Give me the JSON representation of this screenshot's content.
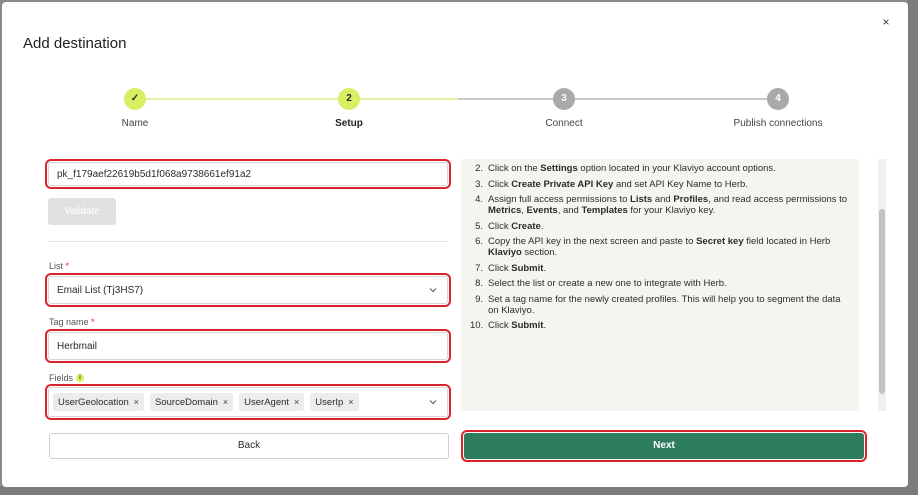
{
  "modal": {
    "title": "Add destination",
    "close_glyph": "×"
  },
  "stepper": {
    "steps": [
      {
        "label": "Name",
        "marker": "✓",
        "state": "done"
      },
      {
        "label": "Setup",
        "marker": "2",
        "state": "active"
      },
      {
        "label": "Connect",
        "marker": "3",
        "state": "pending"
      },
      {
        "label": "Publish connections",
        "marker": "4",
        "state": "pending"
      }
    ]
  },
  "form": {
    "api_key_value": "pk_f179aef22619b5d1f068a9738661ef91a2",
    "validate_label": "Validate",
    "list_label": "List",
    "list_value": "Email List (Tj3HS7)",
    "tag_label": "Tag name",
    "tag_value": "Herbmail",
    "fields_label": "Fields",
    "fields_info": "i",
    "required_mark": "*",
    "chip_remove": "×",
    "chips": [
      "UserGeolocation",
      "SourceDomain",
      "UserAgent",
      "UserIp"
    ]
  },
  "instructions": {
    "items": [
      {
        "num": "2.",
        "parts": [
          "Click on the ",
          "Settings",
          " option located in your Klaviyo account options."
        ]
      },
      {
        "num": "3.",
        "parts": [
          "Click ",
          "Create Private API Key",
          " and set API Key Name to Herb."
        ]
      },
      {
        "num": "4.",
        "parts": [
          "Assign full access permissions to ",
          "Lists",
          " and ",
          "Profiles",
          ", and read access permissions to ",
          "Metrics",
          ", ",
          "Events",
          ", and ",
          "Templates",
          " for your Klaviyo key."
        ]
      },
      {
        "num": "5.",
        "parts": [
          "Click ",
          "Create",
          "."
        ]
      },
      {
        "num": "6.",
        "parts": [
          "Copy the API key in the next screen and paste to ",
          "Secret key",
          " field located in Herb ",
          "Klaviyo",
          " section."
        ]
      },
      {
        "num": "7.",
        "parts": [
          "Click ",
          "Submit",
          "."
        ]
      },
      {
        "num": "8.",
        "parts": [
          "Select the list or create a new one to integrate with Herb."
        ]
      },
      {
        "num": "9.",
        "parts": [
          "Set a tag name for the newly created profiles. This will help you to segment the data on Klaviyo."
        ]
      },
      {
        "num": "10.",
        "parts": [
          "Click ",
          "Submit",
          "."
        ]
      }
    ]
  },
  "footer": {
    "back_label": "Back",
    "next_label": "Next"
  },
  "colors": {
    "accent_lime": "#d9ef63",
    "primary_green": "#2e7d5f",
    "highlight_red": "#d9242f"
  }
}
